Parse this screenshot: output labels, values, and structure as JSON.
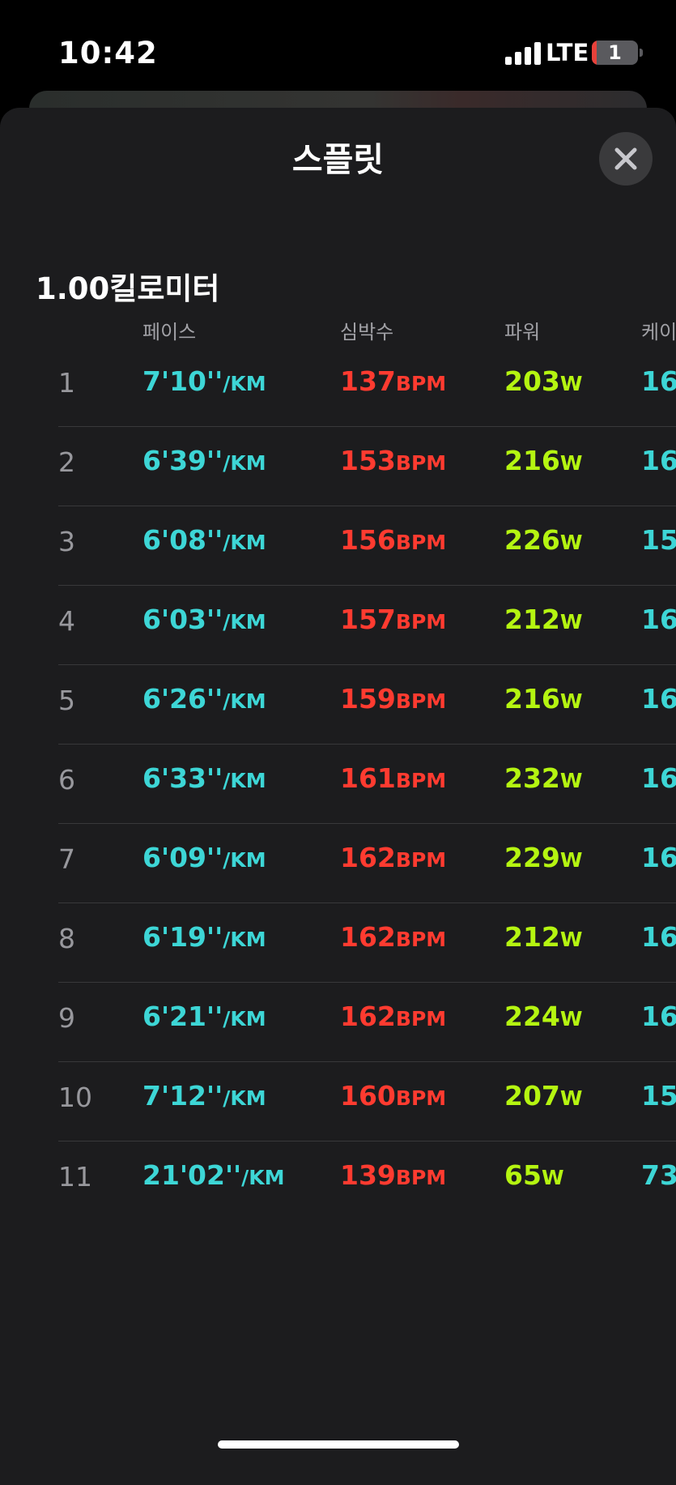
{
  "status_bar": {
    "time": "10:42",
    "network": "LTE",
    "battery_level": "1"
  },
  "sheet": {
    "title": "스플릿",
    "close_icon": "close-icon"
  },
  "section_title": "1.00킬로미터",
  "columns": [
    "페이스",
    "심박수",
    "파워",
    "케이"
  ],
  "units": {
    "pace": "/KM",
    "heart_rate": "BPM",
    "power": "W"
  },
  "colors": {
    "pace": "#3dd6d6",
    "heart_rate": "#ff3b30",
    "power": "#b5f511",
    "cadence": "#3dd6d6"
  },
  "splits": [
    {
      "index": "1",
      "pace": "7'10''",
      "heart_rate": "137",
      "power": "203",
      "cadence": "16"
    },
    {
      "index": "2",
      "pace": "6'39''",
      "heart_rate": "153",
      "power": "216",
      "cadence": "16"
    },
    {
      "index": "3",
      "pace": "6'08''",
      "heart_rate": "156",
      "power": "226",
      "cadence": "15"
    },
    {
      "index": "4",
      "pace": "6'03''",
      "heart_rate": "157",
      "power": "212",
      "cadence": "16"
    },
    {
      "index": "5",
      "pace": "6'26''",
      "heart_rate": "159",
      "power": "216",
      "cadence": "16"
    },
    {
      "index": "6",
      "pace": "6'33''",
      "heart_rate": "161",
      "power": "232",
      "cadence": "16"
    },
    {
      "index": "7",
      "pace": "6'09''",
      "heart_rate": "162",
      "power": "229",
      "cadence": "16"
    },
    {
      "index": "8",
      "pace": "6'19''",
      "heart_rate": "162",
      "power": "212",
      "cadence": "16"
    },
    {
      "index": "9",
      "pace": "6'21''",
      "heart_rate": "162",
      "power": "224",
      "cadence": "16"
    },
    {
      "index": "10",
      "pace": "7'12''",
      "heart_rate": "160",
      "power": "207",
      "cadence": "15"
    },
    {
      "index": "11",
      "pace": "21'02''",
      "heart_rate": "139",
      "power": "65",
      "cadence": "73"
    }
  ]
}
